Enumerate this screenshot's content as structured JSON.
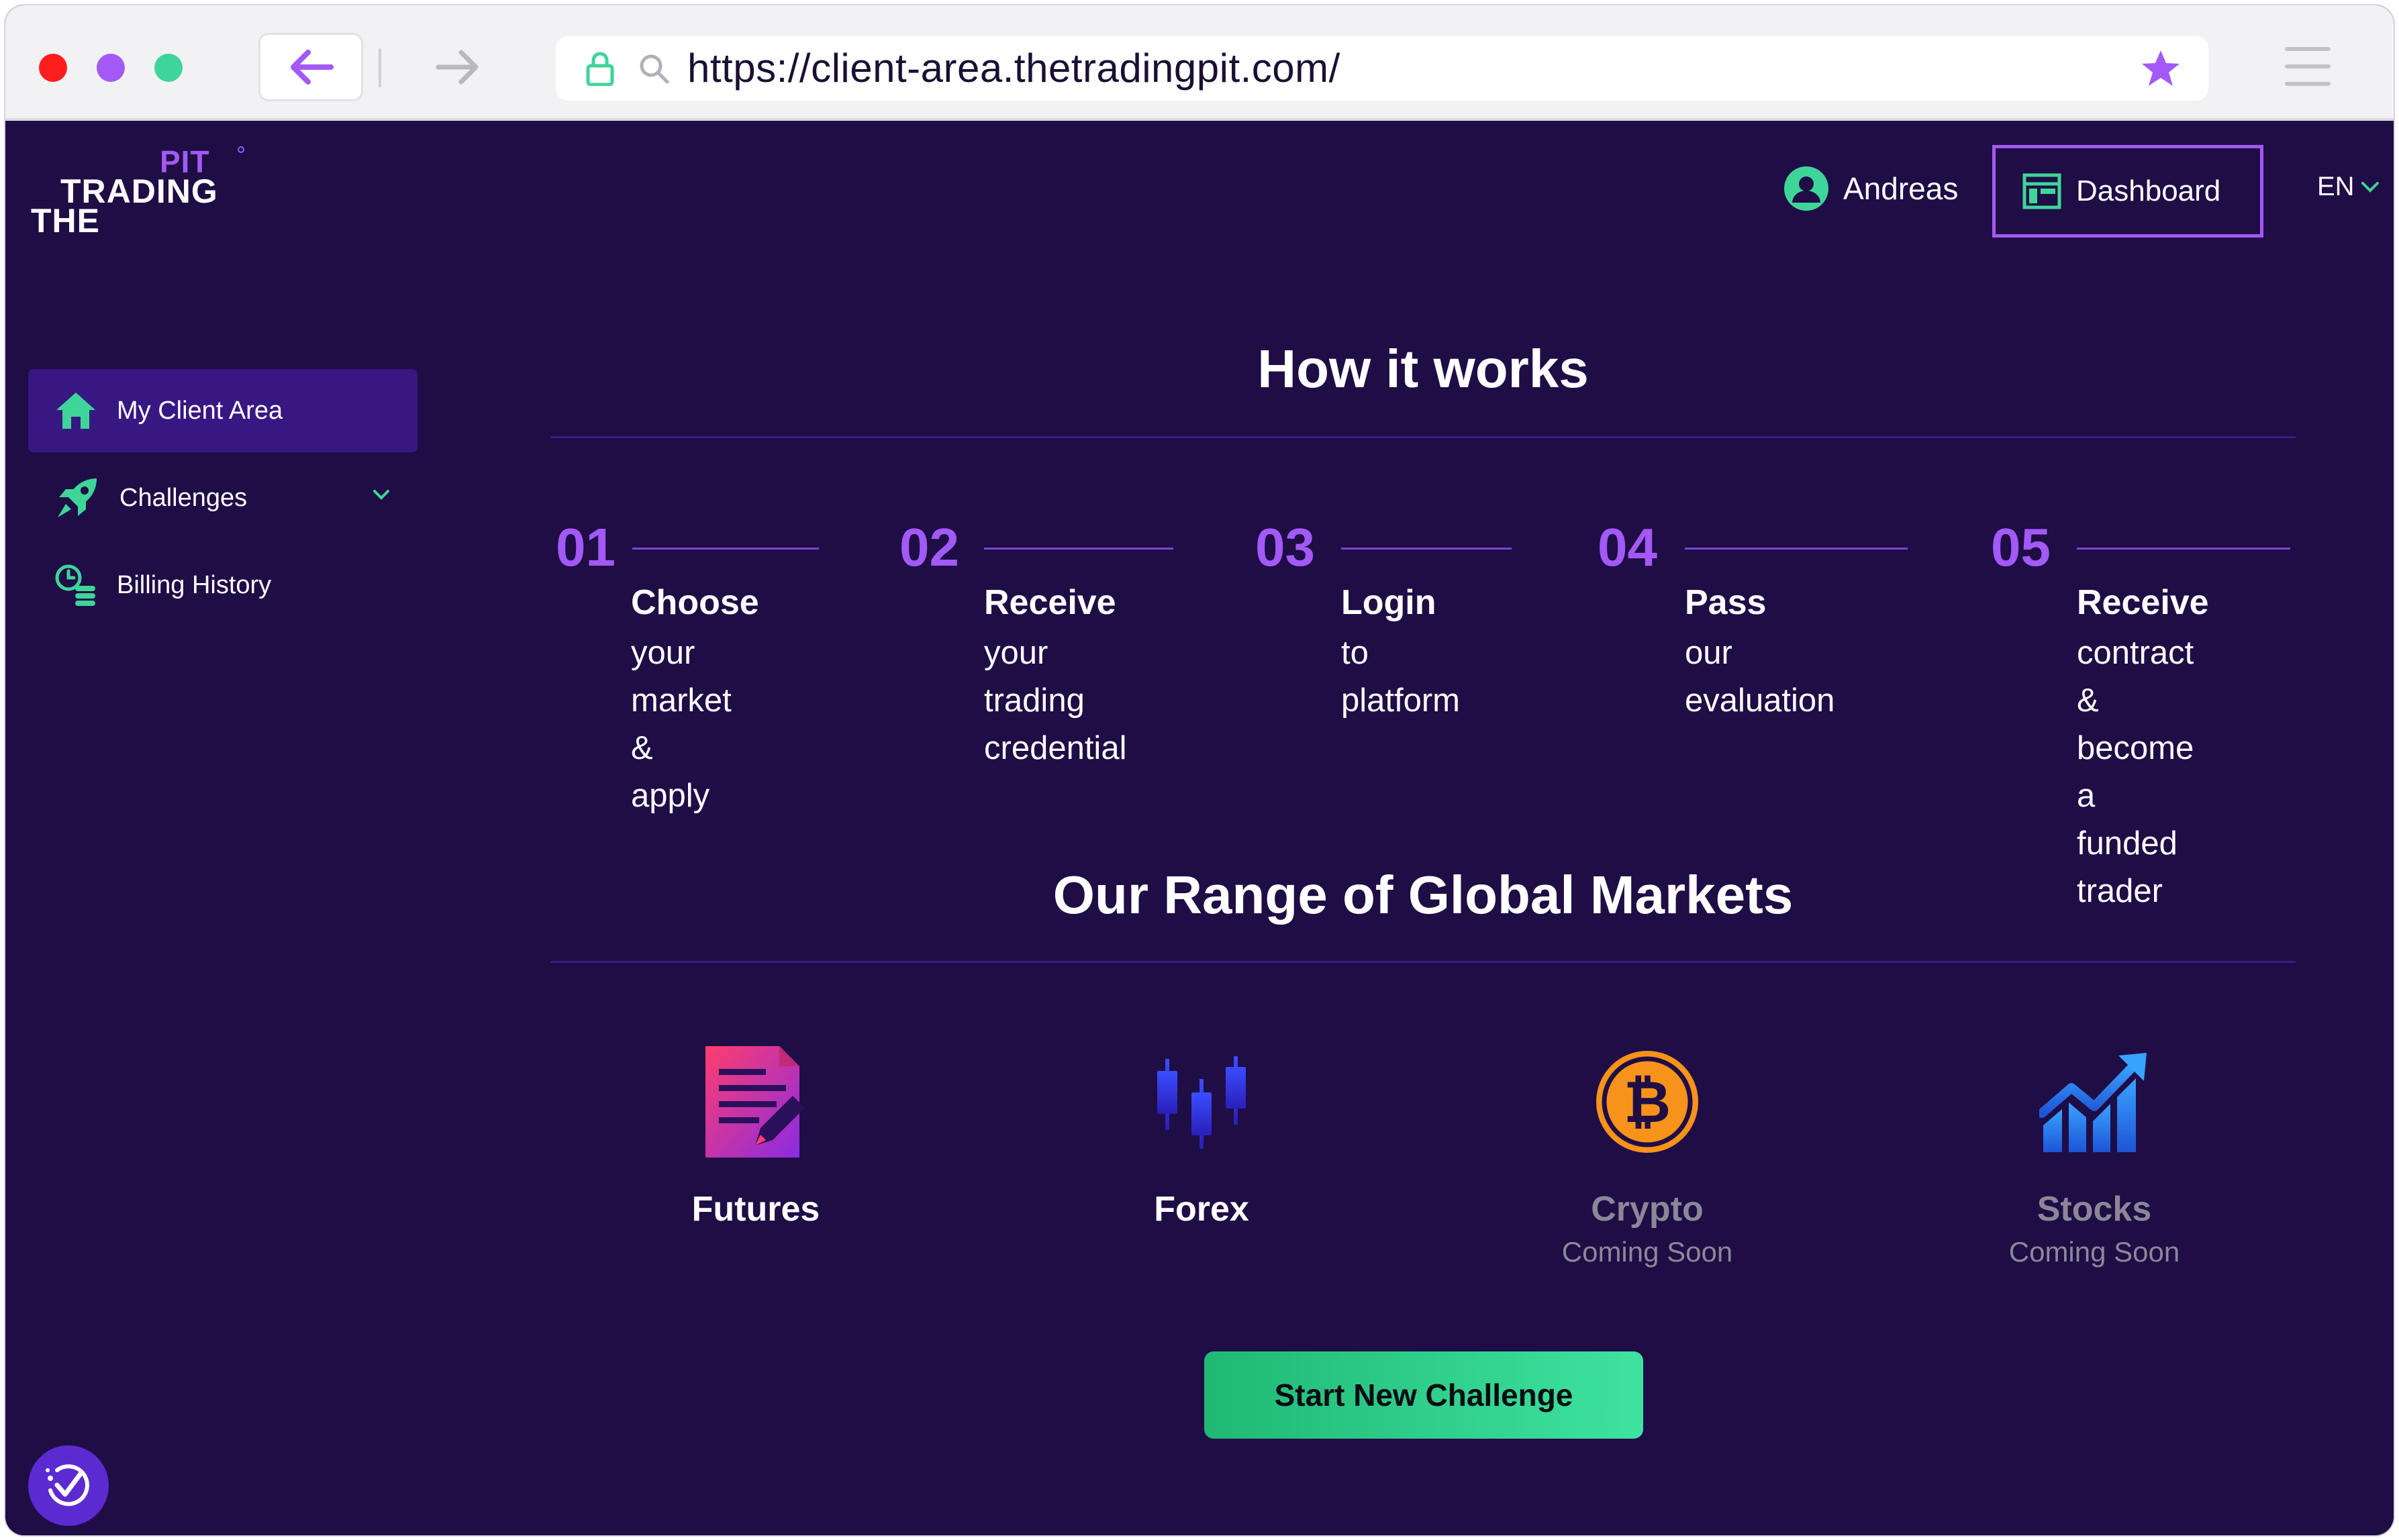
{
  "browser": {
    "url": "https://client-area.thetradingpit.com/"
  },
  "header": {
    "logo": {
      "pit": "PIT",
      "trading": "TRADING",
      "the": "THE"
    },
    "user_name": "Andreas",
    "dashboard_label": "Dashboard",
    "language": "EN"
  },
  "sidebar": {
    "items": [
      {
        "label": "My Client Area",
        "icon": "home-icon",
        "active": true
      },
      {
        "label": "Challenges",
        "icon": "rocket-icon",
        "expandable": true
      },
      {
        "label": "Billing History",
        "icon": "billing-icon"
      }
    ]
  },
  "how_it_works": {
    "title": "How it works",
    "steps": [
      {
        "num": "01",
        "bold": "Choose",
        "desc_lines": [
          "your market",
          "& apply"
        ]
      },
      {
        "num": "02",
        "bold": "Receive",
        "desc_lines": [
          "your trading",
          "credential"
        ]
      },
      {
        "num": "03",
        "bold": "Login",
        "desc_lines": [
          "to platform"
        ]
      },
      {
        "num": "04",
        "bold": "Pass",
        "desc_lines": [
          "our evaluation"
        ]
      },
      {
        "num": "05",
        "bold": "Receive",
        "desc_lines": [
          "contract &",
          "become a",
          "funded trader"
        ]
      }
    ]
  },
  "markets": {
    "title": "Our Range of Global Markets",
    "items": [
      {
        "name": "Futures",
        "icon": "futures-document-icon",
        "status": ""
      },
      {
        "name": "Forex",
        "icon": "forex-candlestick-icon",
        "status": ""
      },
      {
        "name": "Crypto",
        "icon": "bitcoin-icon",
        "status": "Coming Soon"
      },
      {
        "name": "Stocks",
        "icon": "stocks-chart-icon",
        "status": "Coming Soon"
      }
    ]
  },
  "cta_label": "Start New Challenge",
  "colors": {
    "background": "#1f0d46",
    "accent_purple": "#a259f5",
    "accent_green": "#3ed598",
    "sidebar_active": "#391783"
  }
}
